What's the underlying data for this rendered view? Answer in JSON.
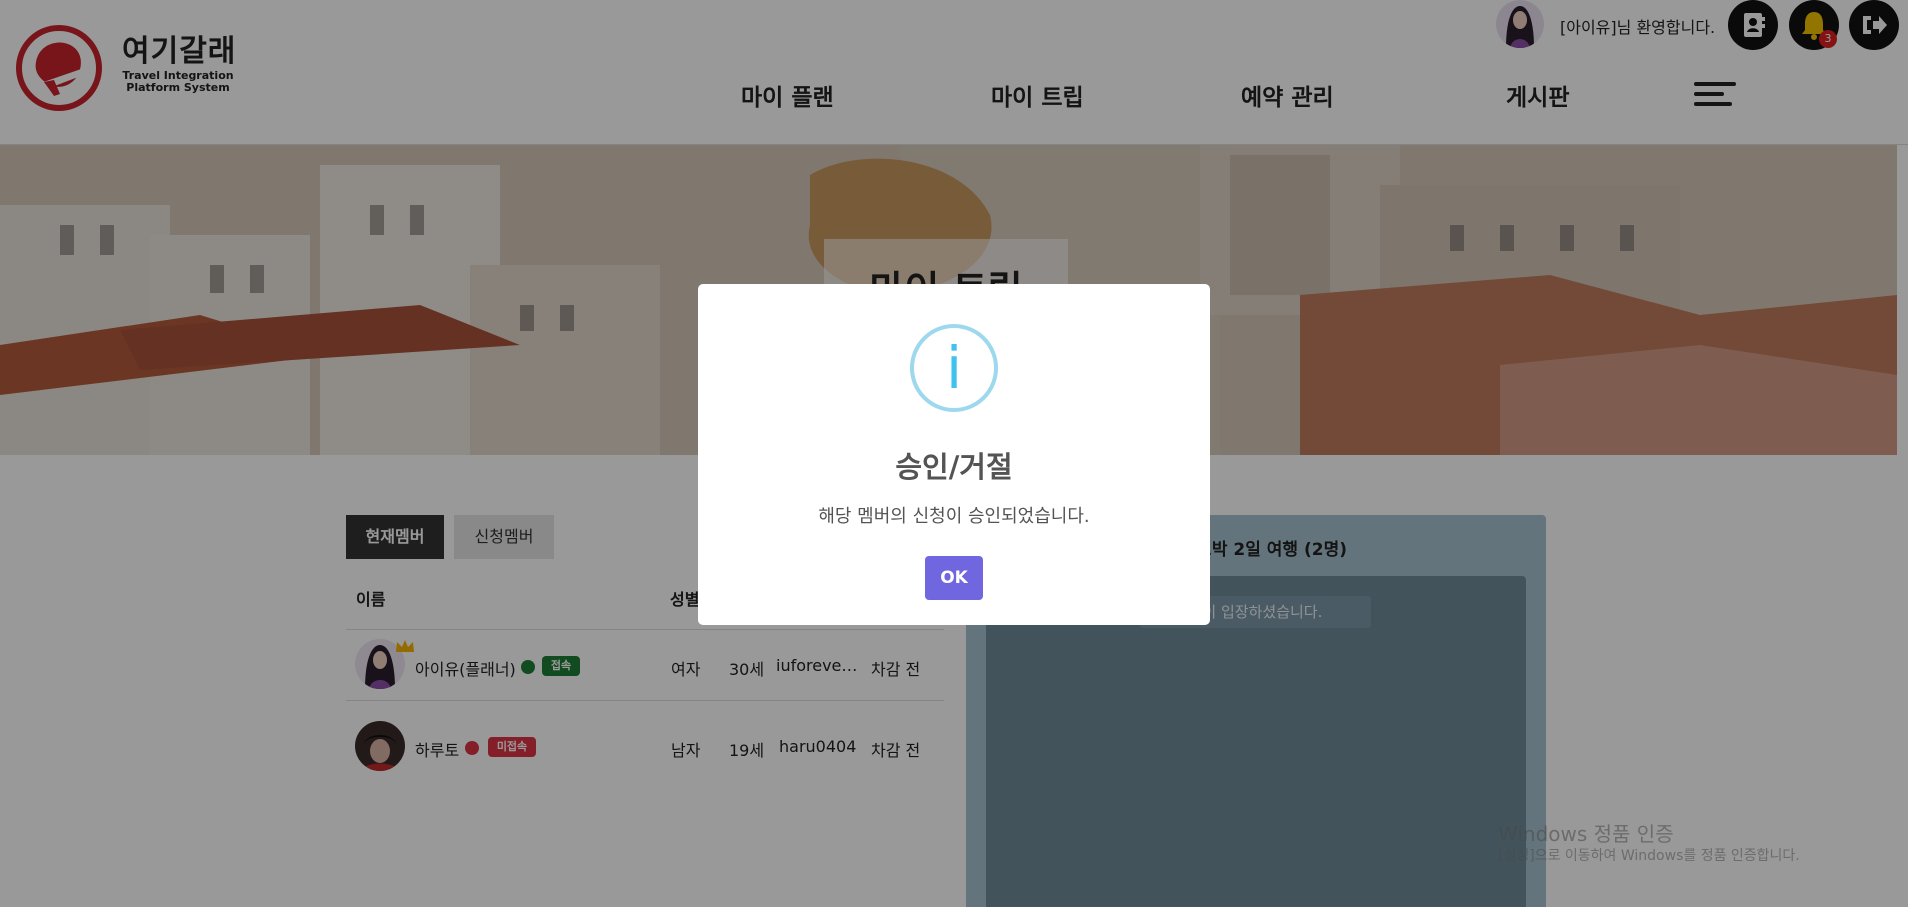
{
  "header": {
    "brand_name": "여기갈래",
    "brand_sub_1": "Travel Integration",
    "brand_sub_2": "Platform System",
    "nav": [
      "마이 플랜",
      "마이 트립",
      "예약 관리",
      "게시판"
    ],
    "welcome": "[아이유]님 환영합니다.",
    "notification_count": "3",
    "icons": [
      "contacts-icon",
      "bell-icon",
      "logout-icon",
      "menu-icon"
    ]
  },
  "banner": {
    "title": "마이 트립"
  },
  "tabs": {
    "current": "현재멤버",
    "applied": "신청멤버"
  },
  "members_table": {
    "headers": {
      "name": "이름",
      "gender": "성별"
    },
    "rows": [
      {
        "name": "아이유(플래너)",
        "status": "접속",
        "gender": "여자",
        "age": "30세",
        "id": "iuforeve…",
        "last": "차감 전"
      },
      {
        "name": "하루토",
        "status": "미접속",
        "gender": "남자",
        "age": "19세",
        "id": "haru0404",
        "last": "차감 전"
      }
    ]
  },
  "chat": {
    "title": "1박 2일 여행 (2명)",
    "notice": "님이 입장하셨습니다."
  },
  "watermark": {
    "line1": "Windows 정품 인증",
    "line2": "[설정]으로 이동하여 Windows를 정품 인증합니다."
  },
  "modal": {
    "icon": "info-icon",
    "icon_glyph": "i",
    "title": "승인/거절",
    "text": "해당 멤버의 신청이 승인되었습니다.",
    "ok_label": "OK"
  },
  "colors": {
    "accent": "#7066e0",
    "info": "#3fc3ee",
    "online": "#1e7e34",
    "offline": "#dc3545",
    "logo_red": "#c8232c"
  }
}
